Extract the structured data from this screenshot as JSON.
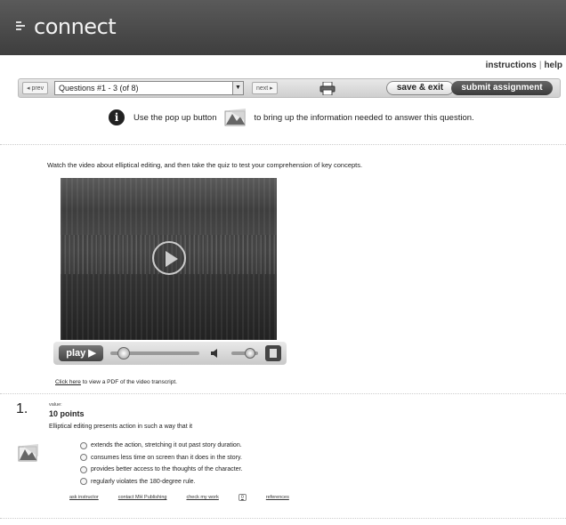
{
  "header": {
    "logo_text": "connect"
  },
  "top_links": {
    "instructions": "instructions",
    "separator": "|",
    "help": "help"
  },
  "toolbar": {
    "prev": "◂ prev",
    "question_select": "Questions #1 - 3 (of 8)",
    "next": "next ▸",
    "save_exit": "save & exit",
    "submit": "submit assignment"
  },
  "info": {
    "before": "Use the pop up button",
    "after": "to bring up the information needed to answer this question."
  },
  "intro": "Watch the video about elliptical editing, and then take the quiz to test your comprehension of key concepts.",
  "video": {
    "play_label": "play ▶",
    "seek_progress": 0.15,
    "volume_level": 0.7
  },
  "transcript": {
    "link": "Click here",
    "rest": " to view a PDF of the video transcript."
  },
  "question": {
    "number": "1.",
    "value_label": "value:",
    "points": "10 points",
    "prompt": "Elliptical editing presents action in such a way that it",
    "options": [
      "extends the action, stretching it out past story duration.",
      "consumes less time on screen than it does in the story.",
      "provides better access to the thoughts of the character.",
      "regularly violates the 180-degree rule."
    ]
  },
  "footer": {
    "ask": "ask instructor",
    "contact": "contact MH Publishing",
    "check": "check my work",
    "ref_icon": "0",
    "references": "references"
  }
}
